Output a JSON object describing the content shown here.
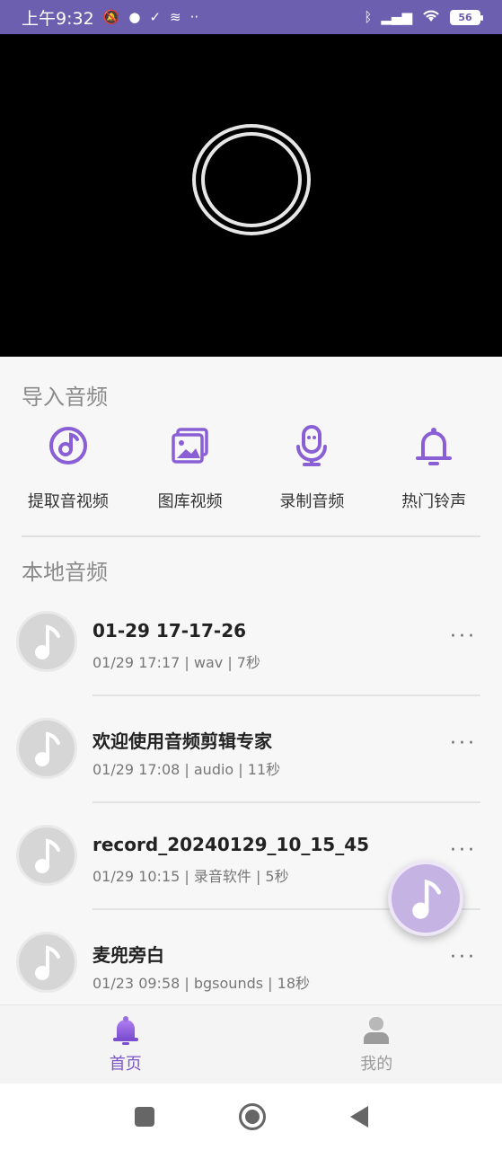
{
  "status_bar": {
    "time": "上午9:32",
    "battery": "56"
  },
  "import_section": {
    "title": "导入音频",
    "items": [
      {
        "label": "提取音视频",
        "icon": "disc-music-icon"
      },
      {
        "label": "图库视频",
        "icon": "gallery-icon"
      },
      {
        "label": "录制音频",
        "icon": "microphone-icon"
      },
      {
        "label": "热门铃声",
        "icon": "bell-icon"
      }
    ]
  },
  "local_section": {
    "title": "本地音频",
    "items": [
      {
        "title": "01-29 17-17-26",
        "meta": "01/29 17:17 | wav | 7秒"
      },
      {
        "title": "欢迎使用音频剪辑专家",
        "meta": "01/29 17:08 | audio | 11秒"
      },
      {
        "title": "record_20240129_10_15_45",
        "meta": "01/29 10:15 | 录音软件 | 5秒"
      },
      {
        "title": "麦兜旁白",
        "meta": "01/23 09:58 | bgsounds | 18秒"
      }
    ],
    "more_label": "···"
  },
  "bottom_nav": {
    "home_label": "首页",
    "mine_label": "我的"
  },
  "colors": {
    "accent": "#8a5fd6",
    "status_bar": "#6c5fb0"
  }
}
